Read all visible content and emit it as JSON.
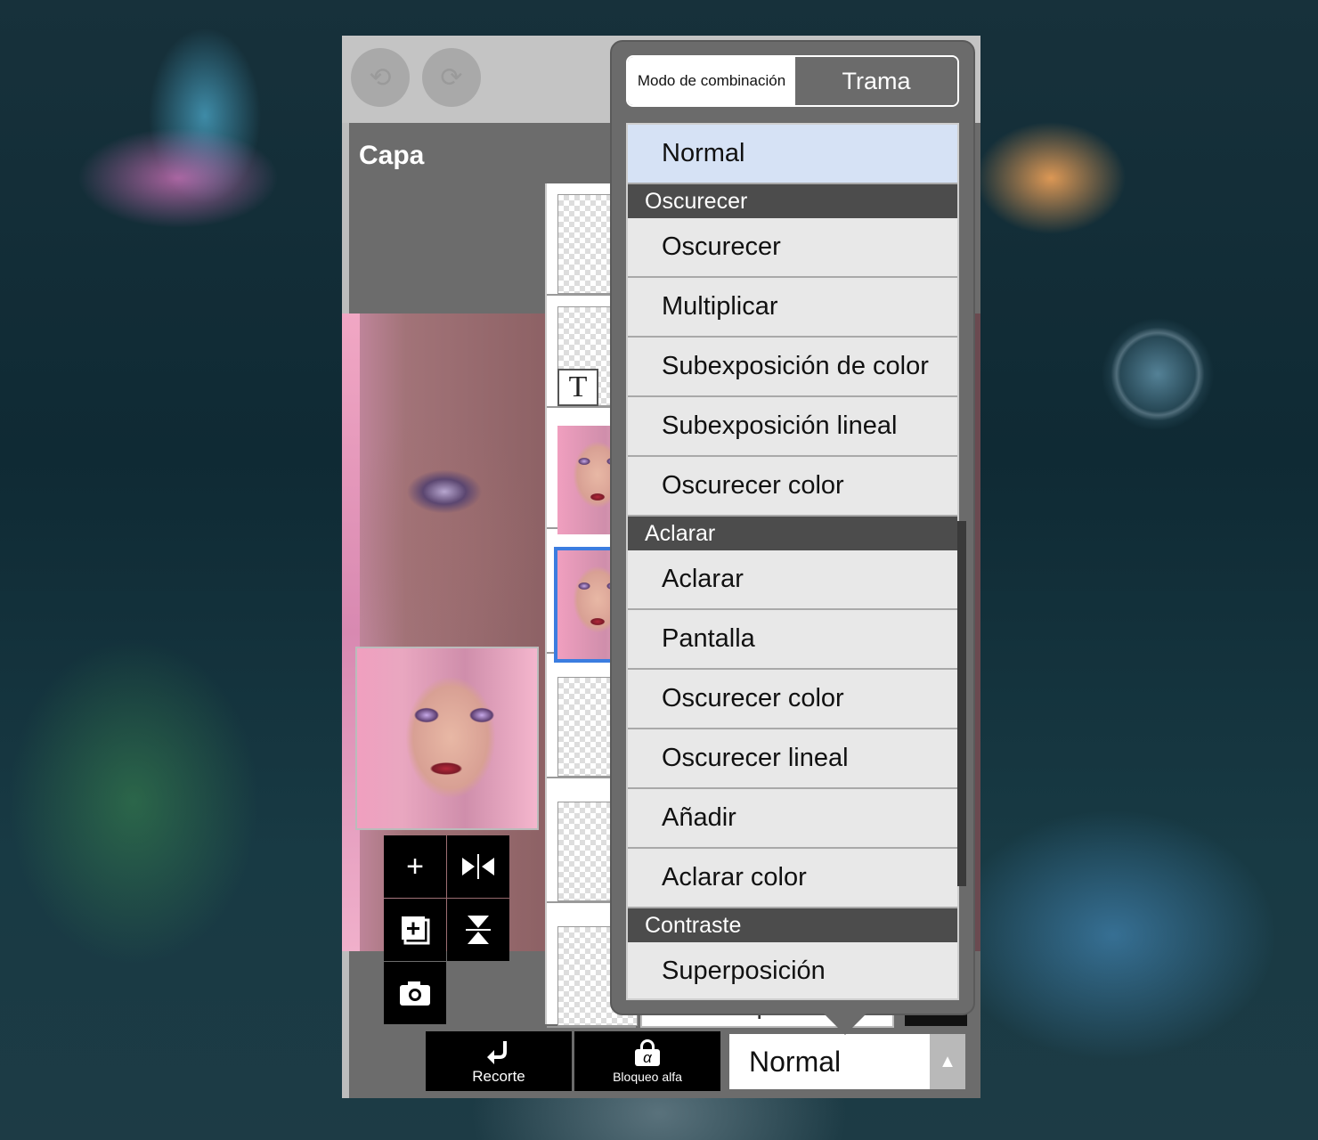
{
  "toolbar": {
    "undo_icon": "undo-icon",
    "redo_icon": "redo-icon"
  },
  "layer_panel": {
    "title": "Capa",
    "text_layer_marker": "T"
  },
  "tools": {
    "add_icon": "plus-icon",
    "flip_icon": "flip-horizontal-icon",
    "add_copy_icon": "add-copy-icon",
    "merge_icon": "merge-down-icon",
    "camera_icon": "camera-icon"
  },
  "bottom_bar": {
    "clipping_label": "Recorte",
    "alpha_lock_label": "Bloqueo alfa",
    "alpha_lock_symbol": "α",
    "blend_value": "Normal",
    "behind_label": "Multiplicar"
  },
  "popup": {
    "tab_blend": "Modo de combinación",
    "tab_screentone": "Trama",
    "menu": [
      {
        "type": "item",
        "label": "Normal",
        "selected": true
      },
      {
        "type": "header",
        "label": "Oscurecer"
      },
      {
        "type": "item",
        "label": "Oscurecer"
      },
      {
        "type": "item",
        "label": "Multiplicar"
      },
      {
        "type": "item",
        "label": "Subexposición de color"
      },
      {
        "type": "item",
        "label": "Subexposición lineal"
      },
      {
        "type": "item",
        "label": "Oscurecer color"
      },
      {
        "type": "header",
        "label": "Aclarar"
      },
      {
        "type": "item",
        "label": "Aclarar"
      },
      {
        "type": "item",
        "label": "Pantalla"
      },
      {
        "type": "item",
        "label": "Oscurecer color"
      },
      {
        "type": "item",
        "label": "Oscurecer lineal"
      },
      {
        "type": "item",
        "label": "Añadir"
      },
      {
        "type": "item",
        "label": "Aclarar color"
      },
      {
        "type": "header",
        "label": "Contraste"
      },
      {
        "type": "item",
        "label": "Superposición"
      }
    ]
  },
  "colors": {
    "selected_item": "#d6e2f5",
    "selected_layer_border": "#3b7de0",
    "header_bg": "#4c4c4c",
    "panel_bg": "#6b6b6b"
  }
}
